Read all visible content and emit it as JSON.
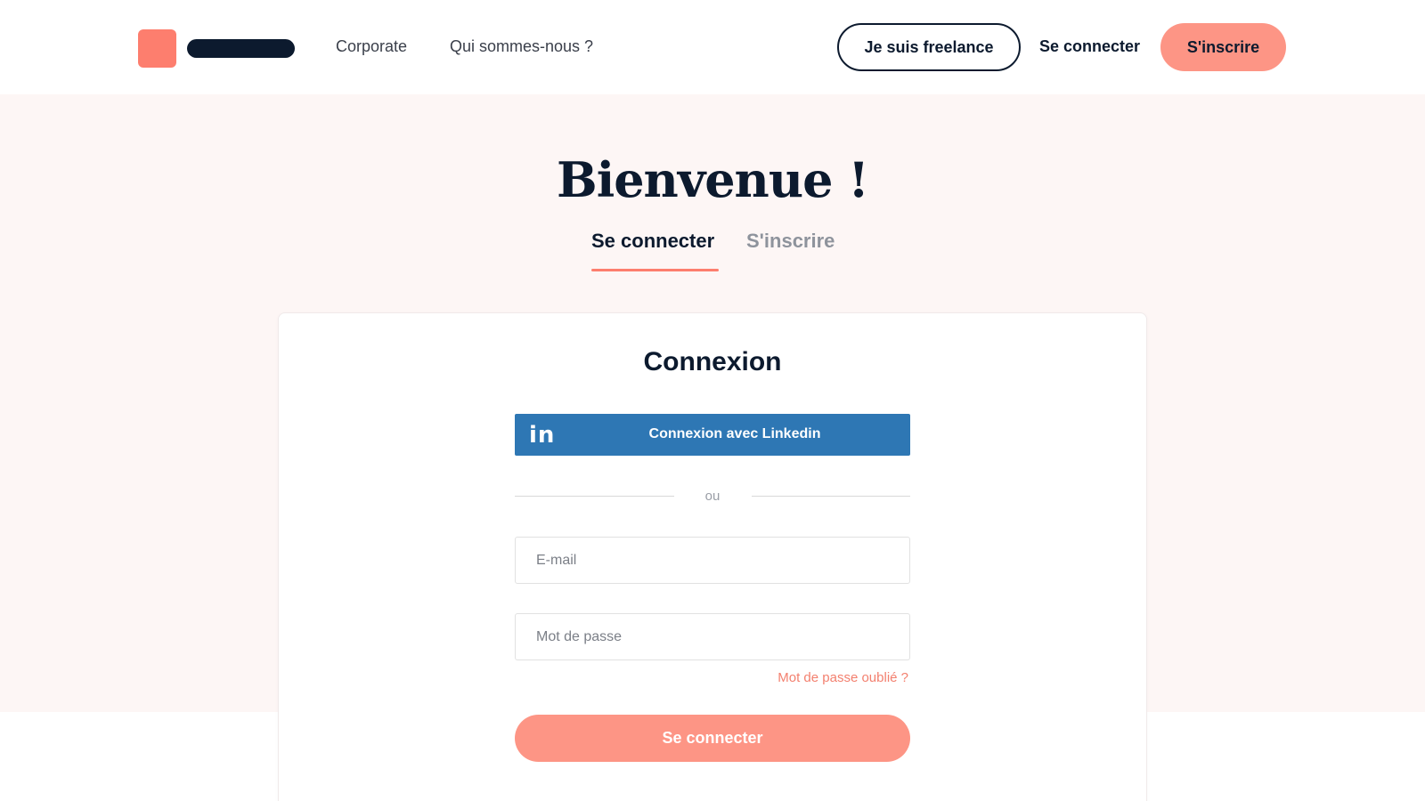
{
  "header": {
    "nav": [
      {
        "label": "Corporate"
      },
      {
        "label": "Qui sommes-nous ?"
      }
    ],
    "freelance_button": "Je suis freelance",
    "login_link": "Se connecter",
    "signup_button": "S'inscrire"
  },
  "hero": {
    "title": "Bienvenue !",
    "tabs": [
      {
        "label": "Se connecter",
        "active": true
      },
      {
        "label": "S'inscrire",
        "active": false
      }
    ]
  },
  "login_card": {
    "title": "Connexion",
    "linkedin_icon": "in",
    "linkedin_button": "Connexion avec Linkedin",
    "separator": "ou",
    "email_placeholder": "E-mail",
    "password_placeholder": "Mot de passe",
    "forgot_password": "Mot de passe oublié ?",
    "submit_button": "Se connecter"
  },
  "colors": {
    "brand": "#fd7e6e",
    "brand_light": "#fd9585",
    "navy": "#0c1a2e",
    "linkedin": "#2e77b4",
    "hero_bg": "#fdf6f5"
  }
}
